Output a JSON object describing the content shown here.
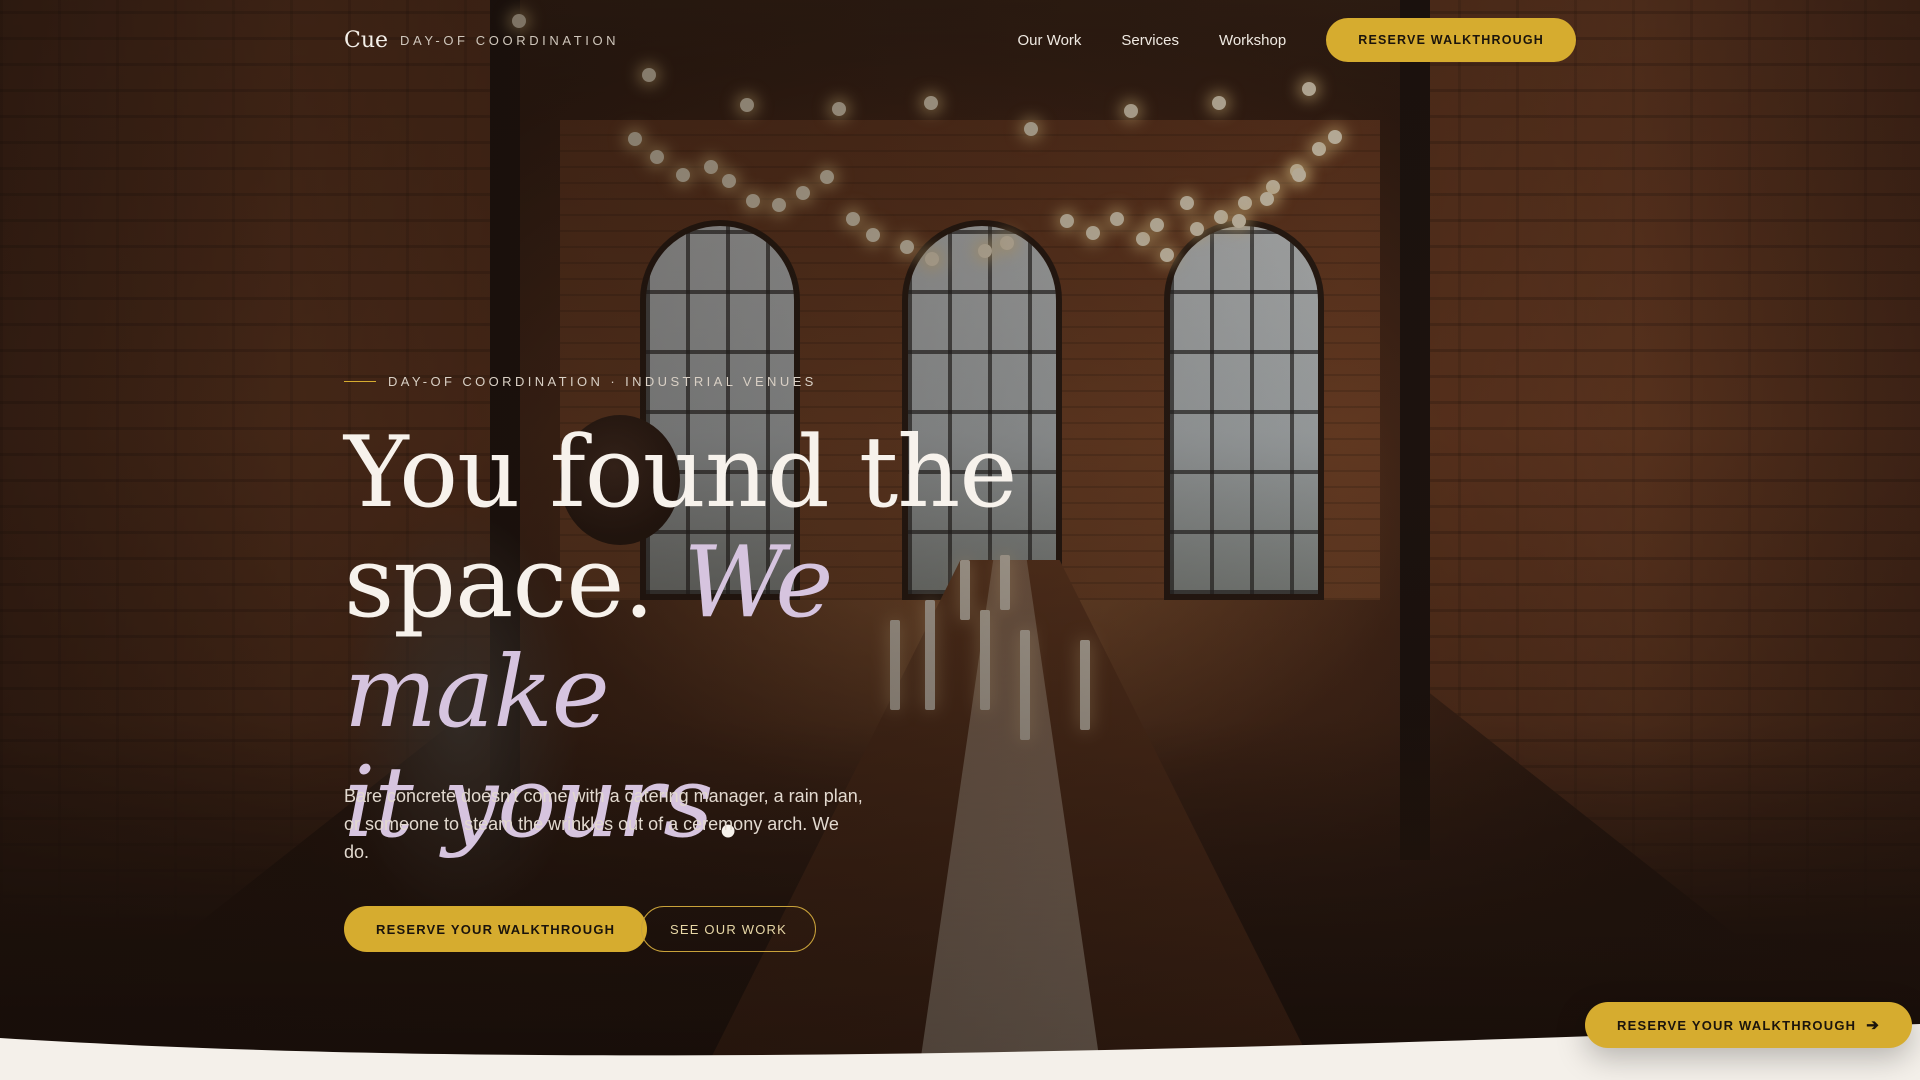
{
  "brand": {
    "logo": "Cue",
    "tagline": "DAY-OF COORDINATION"
  },
  "nav": {
    "links": [
      "Our Work",
      "Services",
      "Workshop"
    ],
    "cta": "RESERVE WALKTHROUGH"
  },
  "hero": {
    "eyebrow": "DAY-OF COORDINATION · INDUSTRIAL VENUES",
    "headline_line1": "You found the",
    "headline_line2_plain": "space.",
    "headline_line2_accent": "We make",
    "headline_line3_accent": "it yours",
    "headline_period": ".",
    "lede": "Bare concrete doesn't come with a catering manager, a rain plan, or someone to steam the wrinkles out of a ceremony arch. We do.",
    "primary_cta": "RESERVE YOUR WALKTHROUGH",
    "secondary_cta": "SEE OUR WORK"
  },
  "floating_cta": {
    "label": "RESERVE YOUR WALKTHROUGH",
    "icon": "arrow-right-icon"
  },
  "colors": {
    "accent_gold": "#d6ac2f",
    "accent_lavender": "#d6c4df",
    "cream": "#f4f0ea"
  }
}
